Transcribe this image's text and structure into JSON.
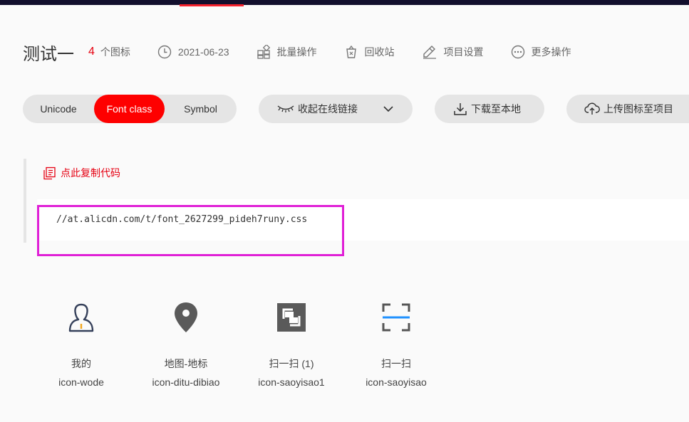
{
  "project": {
    "title": "测试一",
    "icon_count": "4",
    "icon_count_label": "个图标",
    "date": "2021-06-23",
    "actions": {
      "batch": "批量操作",
      "recycle": "回收站",
      "settings": "项目设置",
      "more": "更多操作"
    }
  },
  "toolbar": {
    "tabs": [
      "Unicode",
      "Font class",
      "Symbol"
    ],
    "active_tab": "Font class",
    "collapse_link": "收起在线链接",
    "download": "下载至本地",
    "upload": "上传图标至项目"
  },
  "code": {
    "copy_label": "点此复制代码",
    "url": "//at.alicdn.com/t/font_2627299_pideh7runy.css"
  },
  "icons": [
    {
      "name": "我的",
      "class": "icon-wode",
      "glyph": "user-icon"
    },
    {
      "name": "地图-地标",
      "class": "icon-ditu-dibiao",
      "glyph": "map-pin-icon"
    },
    {
      "name": "扫一扫 (1)",
      "class": "icon-saoyisao1",
      "glyph": "scan-square-icon"
    },
    {
      "name": "扫一扫",
      "class": "icon-saoyisao",
      "glyph": "scan-frame-icon"
    }
  ],
  "colors": {
    "accent": "#fe0000",
    "link": "#e60012",
    "highlight_border": "#e020d6",
    "scan_line": "#1e90ff"
  }
}
